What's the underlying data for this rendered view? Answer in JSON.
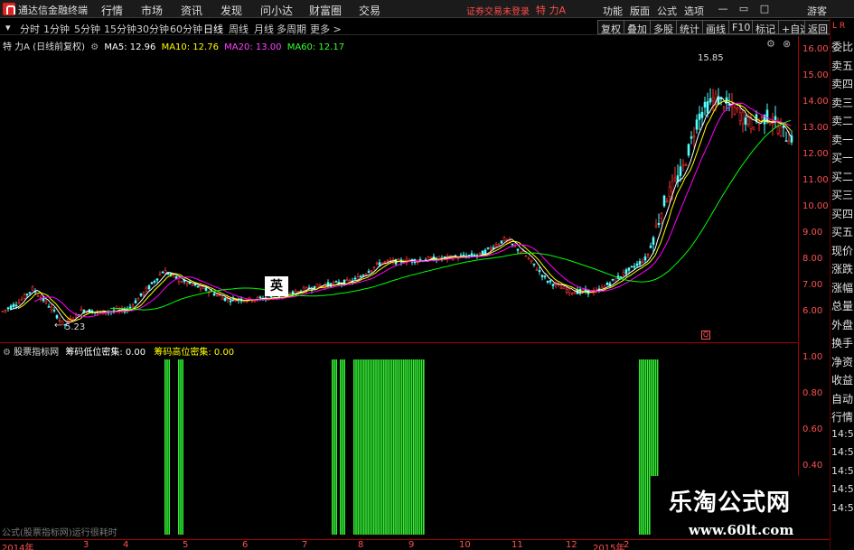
{
  "titlebar": {
    "app_name": "通达信金融终端",
    "menus": [
      "行情",
      "市场",
      "资讯",
      "发现",
      "问小达",
      "财富圈",
      "交易"
    ],
    "status": "证券交易未登录",
    "stock": "特 力A",
    "right_menus": [
      "功能",
      "版面",
      "公式",
      "选项"
    ],
    "user": "游客"
  },
  "periods": [
    "分时",
    "1分钟",
    "5分钟",
    "15分钟",
    "30分钟",
    "60分钟",
    "日线",
    "周线",
    "月线",
    "多周期",
    "更多 >"
  ],
  "active_period": "日线",
  "toolbar": [
    "复权",
    "叠加",
    "多股",
    "统计",
    "画线",
    "F10",
    "标记",
    "+自选",
    "返回"
  ],
  "main_legend": {
    "title": "特 力A (日线前复权)",
    "ma5": "MA5: 12.96",
    "ma10": "MA10: 12.76",
    "ma20": "MA20: 13.00",
    "ma60": "MA60: 12.17"
  },
  "colors": {
    "up": "#ff3232",
    "down": "#54ffff",
    "ma5": "#ffffff",
    "ma10": "#ffff00",
    "ma20": "#ff00ff",
    "ma60": "#00ff00",
    "axis": "#ff5050",
    "bar": "#33ee33"
  },
  "y_ticks": [
    "16.00",
    "15.00",
    "14.00",
    "13.00",
    "12.00",
    "11.00",
    "10.00",
    "9.00",
    "8.00",
    "7.00",
    "6.00"
  ],
  "annotations": {
    "high": "15.85",
    "low": "5.23",
    "ying": "英",
    "marker": "Q"
  },
  "side_head": "L R",
  "side_items": [
    "委比",
    "卖五",
    "卖四",
    "卖三",
    "卖二",
    "卖一",
    "买一",
    "买二",
    "买三",
    "买四",
    "买五",
    "现价",
    "涨跌",
    "涨幅",
    "总量",
    "外盘",
    "换手",
    "净资",
    "收益",
    "自动",
    "行情",
    "14:5",
    "14:5",
    "14:5",
    "14:5",
    "14:5"
  ],
  "indicator": {
    "legend_name": "股票指标网",
    "low_label": "筹码低位密集: 0.00",
    "high_label": "筹码高位密集: 0.00",
    "y_ticks": [
      "1.00",
      "0.80",
      "0.60",
      "0.40"
    ]
  },
  "chart_data": {
    "type": "bar",
    "title": "筹码低位密集 / 筹码高位密集",
    "ylim": [
      0,
      1
    ],
    "series": [
      {
        "name": "筹码高位密集",
        "values": [
          {
            "from": 182,
            "to": 188,
            "value": 1
          },
          {
            "from": 197,
            "to": 202,
            "value": 1
          },
          {
            "from": 367,
            "to": 372,
            "value": 1
          },
          {
            "from": 376,
            "to": 382,
            "value": 1
          },
          {
            "from": 391,
            "to": 469,
            "value": 1
          },
          {
            "from": 707,
            "to": 727,
            "value": 1
          }
        ]
      }
    ],
    "x_ticks": [
      "2014年",
      "3",
      "4",
      "5",
      "6",
      "7",
      "8",
      "9",
      "10",
      "11",
      "12",
      "2015年",
      "2"
    ]
  },
  "bottom_note": "公式(股票指标网)运行很耗时",
  "watermark": {
    "title": "乐淘公式网",
    "url": "www.60lt.com"
  }
}
